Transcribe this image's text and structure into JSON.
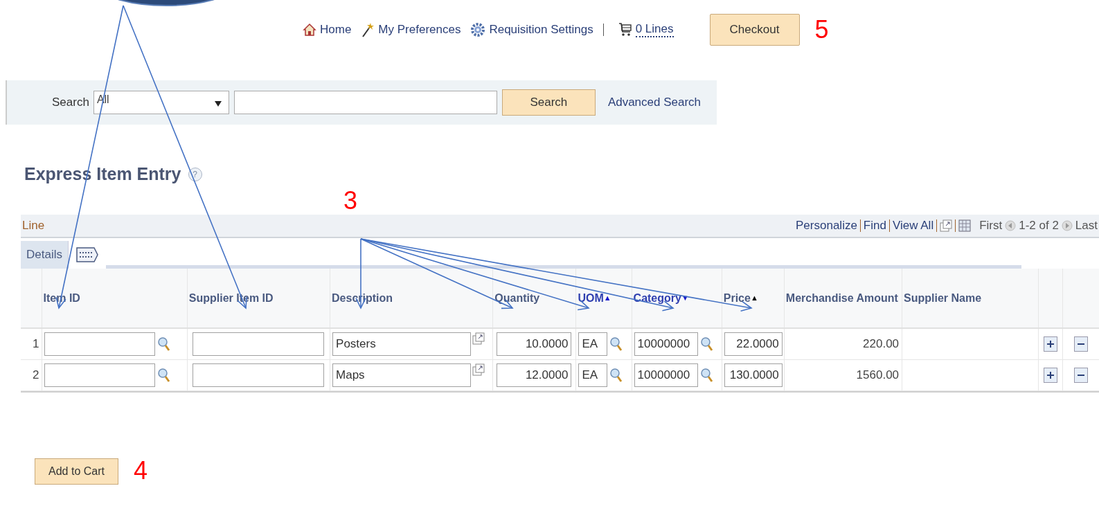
{
  "nav": [
    {
      "kind": "home",
      "label": "Home"
    },
    {
      "kind": "wand",
      "label": "My Preferences"
    },
    {
      "kind": "gear",
      "label": "Requisition Settings"
    },
    {
      "kind": "cart",
      "label": "0 Lines"
    }
  ],
  "checkout": "Checkout",
  "search": {
    "label": "Search",
    "category": "All",
    "button": "Search",
    "advanced": "Advanced Search"
  },
  "title": "Express Item Entry",
  "help": "?",
  "grid": {
    "title": "Line",
    "links": [
      "Personalize",
      "Find",
      "View All"
    ],
    "first": "First",
    "range": "1-2 of 2",
    "last": "Last",
    "tabs": [
      {
        "label": "Details",
        "selected": true
      }
    ],
    "columns": [
      {
        "label": "Item ID"
      },
      {
        "label": "Supplier Item ID"
      },
      {
        "label": "Description"
      },
      {
        "label": "Quantity"
      },
      {
        "label": "UOM",
        "sort": "▲",
        "primary": false
      },
      {
        "label": "Category",
        "sort": "▼",
        "primary": false
      },
      {
        "label": "Price",
        "sort": "▲",
        "primary": true
      },
      {
        "label": "Merchandise Amount"
      },
      {
        "label": "Supplier Name"
      }
    ],
    "rows": [
      {
        "num": "1",
        "description": "Posters",
        "quantity": "10.0000",
        "uom": "EA",
        "category": "10000000",
        "price": "22.0000",
        "amount": "220.00"
      },
      {
        "num": "2",
        "description": "Maps",
        "quantity": "12.0000",
        "uom": "EA",
        "category": "10000000",
        "price": "130.0000",
        "amount": "1560.00"
      }
    ]
  },
  "add_to_cart": "Add to Cart",
  "annotations": {
    "checkout": "5",
    "columns": "3",
    "add_to_cart": "4"
  }
}
